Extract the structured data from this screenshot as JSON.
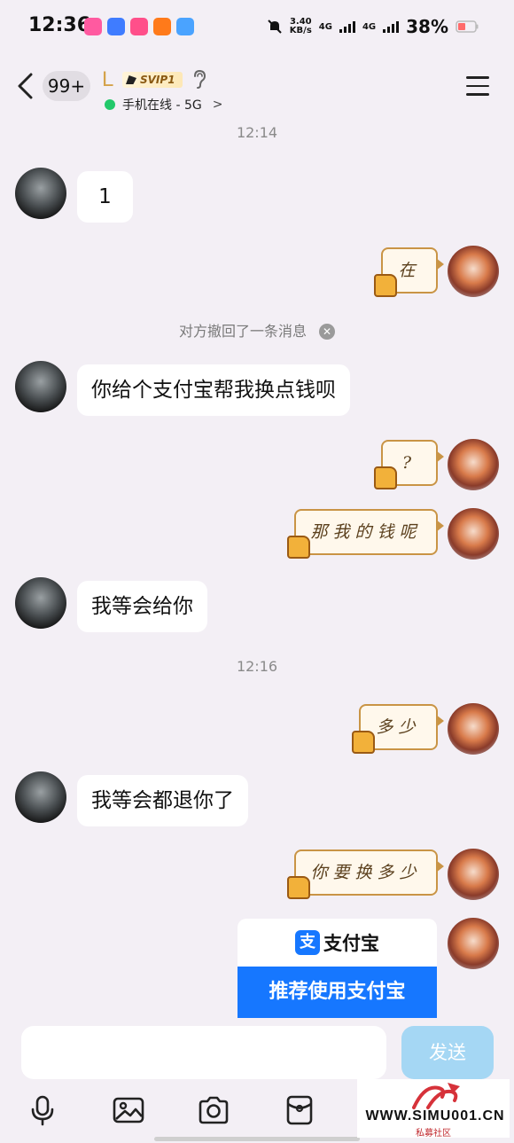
{
  "status_bar": {
    "time": "12:36",
    "net_speed_value": "3.40",
    "net_speed_unit": "KB/s",
    "net_type_1": "4G",
    "net_type_2": "4G",
    "battery": "38%",
    "app_icon_colors": [
      "#ff5aa0",
      "#3f7cff",
      "#ff4f8a",
      "#ff7a1a",
      "#4aa3ff"
    ]
  },
  "header": {
    "unread_badge": "99+",
    "contact_name": "L",
    "vip_badge": "SVIP1",
    "status_text": "手机在线 - 5G",
    "status_arrow": ">"
  },
  "chat": {
    "time_1": "12:14",
    "msg_1": "1",
    "sticker_1": "在",
    "recall_notice": "对方撤回了一条消息",
    "msg_2": "你给个支付宝帮我换点钱呗",
    "sticker_2": "?",
    "sticker_3": "那我的钱呢",
    "msg_3": "我等会给你",
    "time_2": "12:16",
    "sticker_4": "多少",
    "msg_4": "我等会都退你了",
    "sticker_5": "你要换多少",
    "alipay_logo_glyph": "支",
    "alipay_name": "支付宝",
    "alipay_cta": "推荐使用支付宝"
  },
  "input": {
    "placeholder": "",
    "send_label": "发送"
  },
  "toolbar_icons": [
    "microphone-icon",
    "image-icon",
    "camera-icon",
    "red-packet-icon"
  ],
  "watermark": {
    "text": "WWW.SIMU001.CN",
    "sub": "私募社区"
  },
  "colors": {
    "background": "#f3eff5",
    "online_dot": "#22c86a",
    "alipay_blue": "#1677ff",
    "send_button": "#a5d7f4"
  }
}
